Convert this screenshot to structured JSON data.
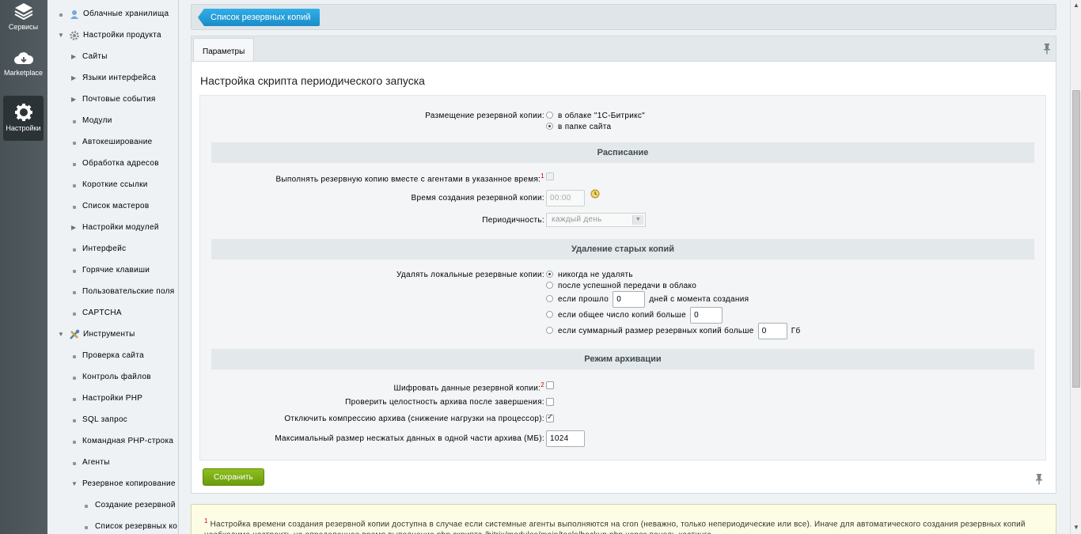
{
  "leftbar": {
    "items": [
      {
        "label": "Сервисы",
        "icon": "layers-icon"
      },
      {
        "label": "Marketplace",
        "icon": "cloud-download-icon"
      },
      {
        "label": "Настройки",
        "icon": "gear-icon"
      }
    ]
  },
  "menu": {
    "cloud_storage": "Облачные хранилища",
    "product_settings": "Настройки продукта",
    "items": [
      "Сайты",
      "Языки интерфейса",
      "Почтовые события",
      "Модули",
      "Автокеширование",
      "Обработка адресов",
      "Короткие ссылки",
      "Список мастеров",
      "Настройки модулей",
      "Интерфейс",
      "Горячие клавиши",
      "Пользовательские поля",
      "CAPTCHA"
    ],
    "tools": "Инструменты",
    "tool_items": [
      "Проверка сайта",
      "Контроль файлов",
      "Настройки PHP",
      "SQL запрос",
      "Командная PHP-строка",
      "Агенты",
      "Резервное копирование"
    ],
    "backup_items": [
      "Создание резервной",
      "Список резервных ко"
    ]
  },
  "header": {
    "back_button": "Список резервных копий"
  },
  "tabs": [
    {
      "label": "Параметры"
    }
  ],
  "panel": {
    "title": "Настройка скрипта периодического запуска",
    "placement": {
      "label": "Размещение резервной копии:",
      "options": [
        "в облаке \"1С-Битрикс\"",
        "в папке сайта"
      ],
      "selected": 1
    },
    "schedule": {
      "section": "Расписание",
      "agents_label": "Выполнять резервную копию вместе с агентами в указанное время:",
      "agents_sup": "1",
      "time_label": "Время создания резервной копии:",
      "time_value": "00:00",
      "period_label": "Периодичность:",
      "period_value": "каждый день"
    },
    "cleanup": {
      "section": "Удаление старых копий",
      "label": "Удалять локальные резервные копии:",
      "opt_never": "никогда не удалять",
      "opt_after_upload": "после успешной передачи в облако",
      "opt_days_prefix": "если прошло",
      "opt_days_value": "0",
      "opt_days_suffix": "дней с момента создания",
      "opt_count_prefix": "если общее число копий больше",
      "opt_count_value": "0",
      "opt_size_prefix": "если суммарный размер резервных копий больше",
      "opt_size_value": "0",
      "opt_size_unit": "Гб"
    },
    "archive": {
      "section": "Режим архивации",
      "encrypt_label": "Шифровать данные резервной копии:",
      "encrypt_sup": "2",
      "check_label": "Проверить целостность архива после завершения:",
      "nocompress_label": "Отключить компрессию архива (снижение нагрузки на процессор):",
      "maxsize_label": "Максимальный размер несжатых данных в одной части архива (МБ):",
      "maxsize_value": "1024"
    },
    "save_button": "Сохранить"
  },
  "note": {
    "sup": "1",
    "text": "Настройка времени создания резервной копии доступна в случае если системные агенты выполняются на cron (неважно, только непериодические или все). Иначе для автоматического создания резервных копий необходимо настроить на определенное время выполнение php скрипта /bitrix/modules/main/tools/backup.php через панель хостинга."
  }
}
